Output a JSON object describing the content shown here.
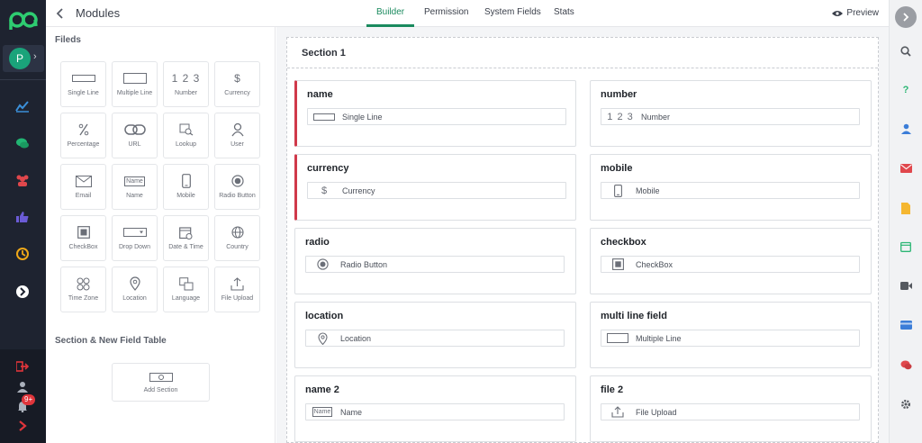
{
  "header": {
    "title": "Modules",
    "tabs": [
      {
        "label": "Builder",
        "active": true
      },
      {
        "label": "Permission",
        "active": false
      },
      {
        "label": "System Fields",
        "active": false
      },
      {
        "label": "Stats",
        "active": false
      }
    ],
    "preview_label": "Preview"
  },
  "sidebar": {
    "avatar_initial": "P",
    "notification_count": "9+",
    "icons": [
      "chart-line-icon",
      "chat-bubbles-icon",
      "users-icon",
      "thumbs-up-icon",
      "history-icon",
      "arrow-right-circle-icon"
    ],
    "bottom_icons": [
      "logout-icon",
      "user-icon",
      "bell-icon",
      "chevron-right-icon"
    ]
  },
  "fields_panel": {
    "heading": "Fileds",
    "tiles": [
      {
        "label": "Single Line",
        "icon": "single-line-icon"
      },
      {
        "label": "Multiple Line",
        "icon": "multiple-line-icon"
      },
      {
        "label": "Number",
        "icon": "number-icon",
        "glyph": "1 2 3"
      },
      {
        "label": "Currency",
        "icon": "currency-icon",
        "glyph": "$"
      },
      {
        "label": "Percentage",
        "icon": "percentage-icon"
      },
      {
        "label": "URL",
        "icon": "link-icon"
      },
      {
        "label": "Lookup",
        "icon": "lookup-icon"
      },
      {
        "label": "User",
        "icon": "user-icon"
      },
      {
        "label": "Email",
        "icon": "envelope-icon"
      },
      {
        "label": "Name",
        "icon": "name-tag-icon",
        "glyph": "Name"
      },
      {
        "label": "Mobile",
        "icon": "mobile-icon"
      },
      {
        "label": "Radio Button",
        "icon": "radio-icon"
      },
      {
        "label": "CheckBox",
        "icon": "checkbox-icon"
      },
      {
        "label": "Drop Down",
        "icon": "dropdown-icon"
      },
      {
        "label": "Date & Time",
        "icon": "calendar-icon"
      },
      {
        "label": "Country",
        "icon": "globe-icon"
      },
      {
        "label": "Time Zone",
        "icon": "time-zone-icon"
      },
      {
        "label": "Location",
        "icon": "location-pin-icon"
      },
      {
        "label": "Language",
        "icon": "language-icon"
      },
      {
        "label": "File Upload",
        "icon": "upload-icon"
      }
    ],
    "section_heading": "Section & New Field Table",
    "add_section_label": "Add Section"
  },
  "builder": {
    "section_title": "Section 1",
    "fields": [
      {
        "name": "name",
        "type_label": "Single Line",
        "icon": "single-line-icon",
        "flagged": true
      },
      {
        "name": "number",
        "type_label": "Number",
        "icon": "number-icon",
        "glyph": "1 2 3",
        "flagged": false
      },
      {
        "name": "currency",
        "type_label": "Currency",
        "icon": "currency-icon",
        "glyph": "$",
        "flagged": true
      },
      {
        "name": "mobile",
        "type_label": "Mobile",
        "icon": "mobile-icon",
        "flagged": false
      },
      {
        "name": "radio",
        "type_label": "Radio Button",
        "icon": "radio-icon",
        "flagged": false
      },
      {
        "name": "checkbox",
        "type_label": "CheckBox",
        "icon": "checkbox-icon",
        "flagged": false
      },
      {
        "name": "location",
        "type_label": "Location",
        "icon": "location-pin-icon",
        "flagged": false
      },
      {
        "name": "multi line field",
        "type_label": "Multiple Line",
        "icon": "multiple-line-icon",
        "flagged": false
      },
      {
        "name": "name 2",
        "type_label": "Name",
        "icon": "name-tag-icon",
        "glyph": "Name",
        "flagged": false
      },
      {
        "name": "file 2",
        "type_label": "File Upload",
        "icon": "upload-icon",
        "flagged": false
      }
    ]
  },
  "right_rail": {
    "icons": [
      "collapse-icon",
      "search-icon",
      "help-icon",
      "contacts-icon",
      "mail-icon",
      "document-icon",
      "calendar-icon",
      "video-icon",
      "card-icon",
      "chat-icon",
      "settings-icon"
    ]
  },
  "colors": {
    "accent": "#1a8a5e",
    "sidebar_bg": "#1e2330",
    "required_marker": "#d0394a",
    "logo": "#2ecc71"
  }
}
